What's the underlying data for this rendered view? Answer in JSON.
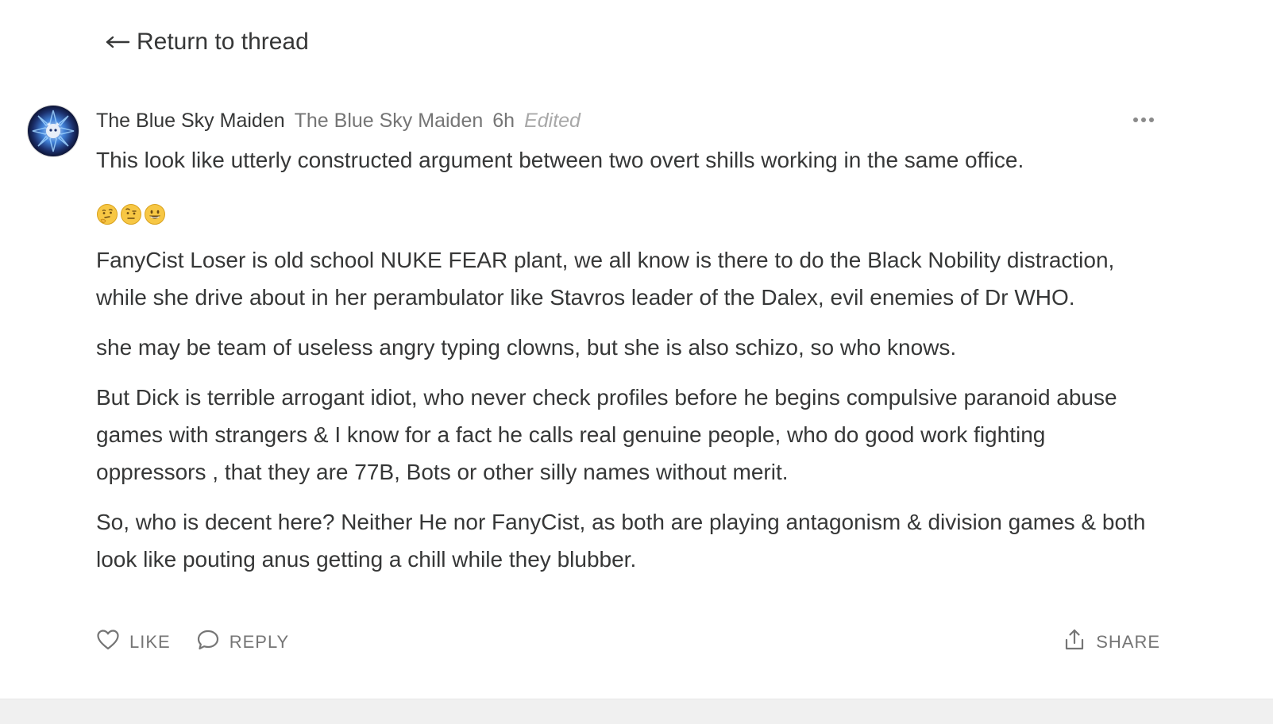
{
  "nav": {
    "return_label": "Return to thread"
  },
  "comment": {
    "author_name": "The Blue Sky Maiden",
    "author_handle": "The Blue Sky Maiden",
    "timestamp": "6h",
    "edited_label": "Edited",
    "paragraphs": [
      "This look like utterly constructed argument between two overt shills working in the same office.",
      "FanyCist Loser is old school NUKE FEAR plant, we all know is there to do the Black Nobility distraction, while she drive about in her perambulator like Stavros leader of the Dalex, evil enemies of Dr WHO.",
      "she may be team of useless angry typing clowns, but she is also schizo, so who knows.",
      "But Dick is terrible arrogant idiot, who never check profiles before he begins compulsive paranoid abuse games with strangers & I know for a fact he calls real genuine people, who do good work fighting oppressors , that they are 77B, Bots or other silly names without merit.",
      "So, who is decent here? Neither He nor FanyCist, as both are playing antagonism & division games & both look like pouting anus getting a chill while they blubber."
    ],
    "emojis": [
      "thinking-face-emoji",
      "face-with-raised-eyebrow-emoji",
      "grinning-face-emoji"
    ]
  },
  "actions": {
    "like_label": "LIKE",
    "reply_label": "REPLY",
    "share_label": "SHARE"
  },
  "icons": {
    "back": "left-arrow-icon",
    "more": "more-horizontal-icon",
    "like": "heart-icon",
    "reply": "speech-bubble-icon",
    "share": "share-upload-icon"
  },
  "colors": {
    "text_primary": "#363737",
    "text_secondary": "#757575",
    "text_muted": "#a8a8a8",
    "emoji_yellow": "#f7c744"
  }
}
